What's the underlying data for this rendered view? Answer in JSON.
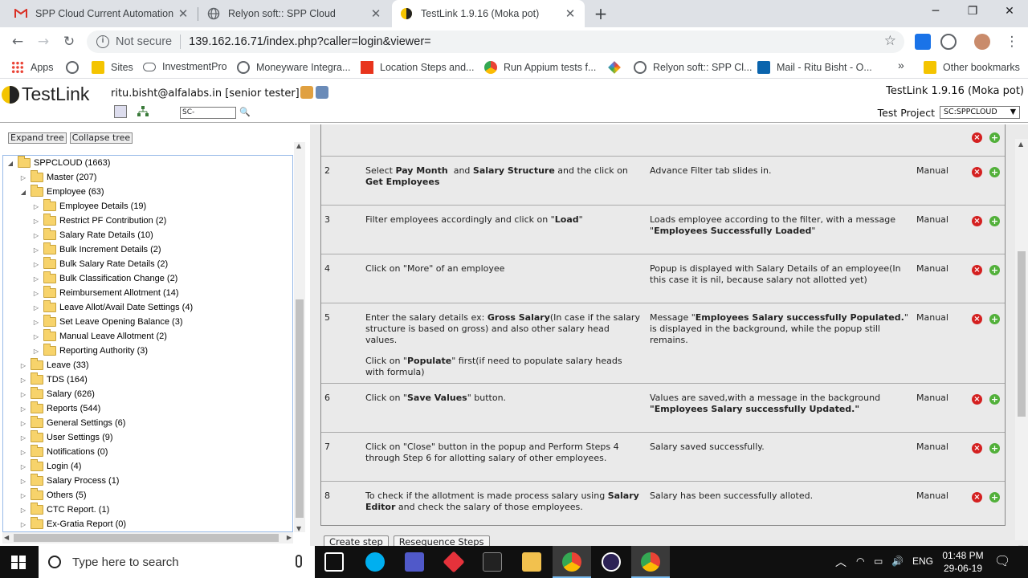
{
  "browser": {
    "tabs": [
      {
        "title": "SPP Cloud Current Automation S",
        "icon": "gmail-icon"
      },
      {
        "title": "Relyon soft:: SPP Cloud",
        "icon": "globe-icon"
      },
      {
        "title": "TestLink 1.9.16 (Moka pot)",
        "icon": "testlink-icon",
        "active": true
      }
    ],
    "not_secure": "Not secure",
    "url": "139.162.16.71/index.php?caller=login&viewer=",
    "bookmarks": [
      "Apps",
      "Sites",
      "InvestmentPro",
      "Moneyware Integra...",
      "Location Steps and...",
      "Run Appium tests f...",
      "Relyon soft:: SPP Cl...",
      "Mail - Ritu Bisht - O..."
    ],
    "bookmarks_more": "»",
    "other_bookmarks": "Other bookmarks"
  },
  "testlink": {
    "logo": "TestLink",
    "user": "ritu.bisht@alfalabs.in [senior tester]",
    "version": "TestLink 1.9.16 (Moka pot)",
    "search_value": "SC-",
    "project_label": "Test Project",
    "project_value": "SC:SPPCLOUD"
  },
  "tree": {
    "expand": "Expand tree",
    "collapse": "Collapse tree",
    "nodes": [
      {
        "label": "SPPCLOUD (1663)",
        "level": 0,
        "open": true
      },
      {
        "label": "Master (207)",
        "level": 1
      },
      {
        "label": "Employee (63)",
        "level": 1,
        "open": true
      },
      {
        "label": "Employee Details (19)",
        "level": 2
      },
      {
        "label": "Restrict PF Contribution (2)",
        "level": 2
      },
      {
        "label": "Salary Rate Details (10)",
        "level": 2
      },
      {
        "label": "Bulk Increment Details (2)",
        "level": 2
      },
      {
        "label": "Bulk Salary Rate Details (2)",
        "level": 2
      },
      {
        "label": "Bulk Classification Change (2)",
        "level": 2
      },
      {
        "label": "Reimbursement Allotment (14)",
        "level": 2
      },
      {
        "label": "Leave Allot/Avail Date Settings (4)",
        "level": 2
      },
      {
        "label": "Set Leave Opening Balance (3)",
        "level": 2
      },
      {
        "label": "Manual Leave Allotment (2)",
        "level": 2
      },
      {
        "label": "Reporting Authority (3)",
        "level": 2
      },
      {
        "label": "Leave (33)",
        "level": 1
      },
      {
        "label": "TDS (164)",
        "level": 1
      },
      {
        "label": "Salary (626)",
        "level": 1
      },
      {
        "label": "Reports (544)",
        "level": 1
      },
      {
        "label": "General Settings (6)",
        "level": 1
      },
      {
        "label": "User Settings (9)",
        "level": 1
      },
      {
        "label": "Notifications (0)",
        "level": 1
      },
      {
        "label": "Login (4)",
        "level": 1
      },
      {
        "label": "Salary Process (1)",
        "level": 1
      },
      {
        "label": "Others (5)",
        "level": 1
      },
      {
        "label": "CTC Report. (1)",
        "level": 1
      },
      {
        "label": "Ex-Gratia Report (0)",
        "level": 1
      }
    ]
  },
  "steps": [
    {
      "num": "2",
      "action_html": "Select <b>Pay Month</b>&nbsp; and <b>Salary Structure</b> and the click on <b>Get Employees</b>",
      "result_html": "Advance Filter tab slides in.",
      "exec": "Manual"
    },
    {
      "num": "3",
      "action_html": "Filter employees accordingly and click on \"<b>Load</b>\"",
      "result_html": "Loads employee according to the filter, with a message \"<b>Employees Successfully Loaded</b>\"",
      "exec": "Manual"
    },
    {
      "num": "4",
      "action_html": "Click on \"More\" of an employee",
      "result_html": "Popup is displayed with Salary Details of an employee(In this case it is nil, because salary not allotted yet)",
      "exec": "Manual"
    },
    {
      "num": "5",
      "action_html": "<p>Enter the salary details ex: <b>Gross Salary</b>(In case if the salary structure is based on gross) and also other salary head values.</p><p>Click on \"<b>Populate</b>\" first(if need to populate salary heads with formula)</p>",
      "result_html": "Message \"<b>Employees Salary successfully Populated.</b>\" is displayed in the background, while the popup still remains.",
      "exec": "Manual"
    },
    {
      "num": "6",
      "action_html": "Click on \"<b>Save Values</b>\" button.",
      "result_html": "Values are saved,with a message in the background <b>\"Employees Salary successfully Updated.\"</b>",
      "exec": "Manual"
    },
    {
      "num": "7",
      "action_html": "Click on \"Close\" button in the popup and Perform Steps 4 through Step 6 for allotting salary of other employees.",
      "result_html": "Salary saved successfully.",
      "exec": "Manual"
    },
    {
      "num": "8",
      "action_html": "To check if the allotment is made process salary using <b>Salary Editor</b> and check the salary of those employees.",
      "result_html": "Salary has been successfully alloted.",
      "exec": "Manual"
    }
  ],
  "buttons": {
    "create_step": "Create step",
    "resequence": "Resequence Steps"
  },
  "taskbar": {
    "search_placeholder": "Type here to search",
    "lang": "ENG",
    "time": "01:48 PM",
    "date": "29-06-19"
  },
  "colors": {
    "delete": "#d42020",
    "add": "#52b03a",
    "folder": "#f7d36b"
  }
}
